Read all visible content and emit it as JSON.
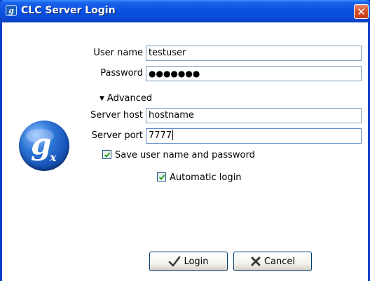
{
  "window": {
    "title": "CLC Server Login",
    "title_icon_glyph": "g",
    "close_glyph": "✕"
  },
  "form": {
    "username": {
      "label": "User name",
      "value": "testuser"
    },
    "password": {
      "label": "Password",
      "masked": "●●●●●●●"
    },
    "advanced": {
      "label": "Advanced",
      "expanded": true
    },
    "server_host": {
      "label": "Server host",
      "value": "hostname"
    },
    "server_port": {
      "label": "Server port",
      "value": "7777"
    },
    "save_credentials": {
      "label": "Save user name and password",
      "checked": true
    },
    "automatic_login": {
      "label": "Automatic login",
      "checked": true
    }
  },
  "buttons": {
    "login": {
      "label": "Login",
      "icon": "checkmark-icon"
    },
    "cancel": {
      "label": "Cancel",
      "icon": "x-icon"
    }
  },
  "colors": {
    "titlebar": "#0b52e4",
    "close_button": "#d7502c",
    "logo": "#1653b6",
    "field_border": "#7f9db9",
    "check_green": "#21a121"
  }
}
